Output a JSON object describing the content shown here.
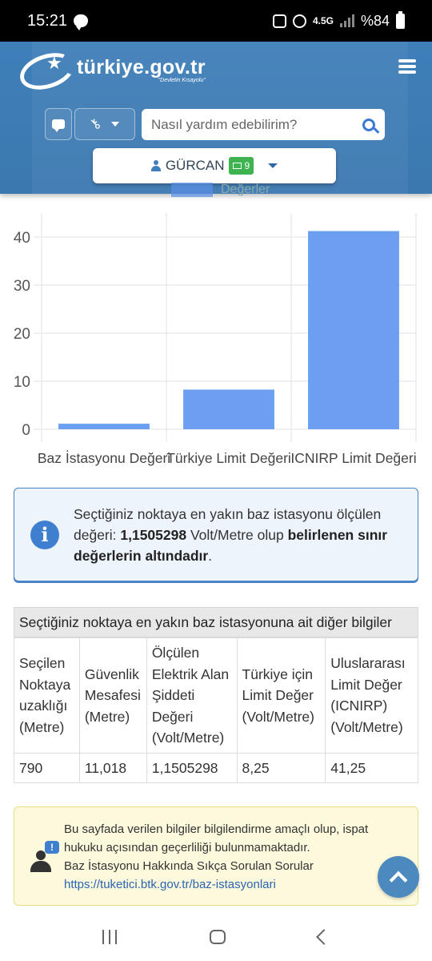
{
  "status_bar": {
    "time": "15:21",
    "network": "4.5G",
    "battery": "%84"
  },
  "header": {
    "logo_text": "türkiye.gov.tr",
    "logo_tagline": "\"Devletin Kısayolu\"",
    "search_placeholder": "Nasıl yardım edebilirim?",
    "user_name": "GÜRCAN",
    "message_count": "9",
    "legend_hint": "Değerler"
  },
  "chart_data": {
    "type": "bar",
    "categories": [
      "Baz İstasyonu Değeri",
      "Türkiye Limit Değeri",
      "ICNIRP Limit Değeri"
    ],
    "values": [
      1.1505298,
      8.25,
      41.25
    ],
    "ylim": [
      0,
      45
    ],
    "yticks": [
      "0",
      "10",
      "20",
      "30",
      "40"
    ],
    "ytick_values": [
      0,
      10,
      20,
      30,
      40
    ],
    "bar_color": "#6d9ff0",
    "grid": true
  },
  "info": {
    "line1": "Seçtiğiniz noktaya en yakın baz istasyonu ölçülen",
    "line2_pre": "değeri: ",
    "value": "1,1505298",
    "line2_mid": " Volt/Metre olup ",
    "line2_bold": "belirlenen sınır",
    "line3_bold": "değerlerin altındadır",
    "line3_end": "."
  },
  "table": {
    "title": "Seçtiğiniz noktaya en yakın baz istasyonuna ait diğer bilgiler",
    "headers": [
      "Seçilen Noktaya uzaklığı (Metre)",
      "Güvenlik Mesafesi (Metre)",
      "Ölçülen Elektrik Alan Şiddeti Değeri (Volt/Metre)",
      "Türkiye için Limit Değer (Volt/Metre)",
      "Uluslararası Limit Değer (ICNIRP) (Volt/Metre)"
    ],
    "row": [
      "790",
      "11,018",
      "1,1505298",
      "8,25",
      "41,25"
    ]
  },
  "notice": {
    "line1": "Bu sayfada verilen bilgiler bilgilendirme amaçlı olup, ispat",
    "line2": "hukuku açısından geçerliliği bulunmamaktadır.",
    "line3": "Baz İstasyonu Hakkında Sıkça Sorulan Sorular",
    "link": "https://tuketici.btk.gov.tr/baz-istasyonlari"
  },
  "colors": {
    "header_bg": "#3f7fb9",
    "accent": "#3a7bd5",
    "badge": "#3fb34f"
  }
}
